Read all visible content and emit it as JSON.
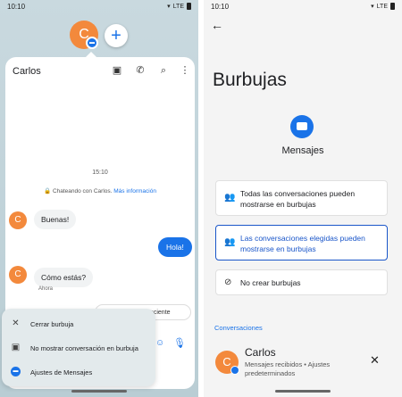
{
  "left": {
    "status": {
      "time": "10:10",
      "wifi_icon": "wifi-icon",
      "signal": "LTE",
      "battery_icon": "battery-icon"
    },
    "bubble": {
      "avatar_letter": "C",
      "add_icon": "+"
    },
    "chat": {
      "contact_name": "Carlos",
      "time_divider": "15:10",
      "info_prefix": "🔒 Chateando con Carlos.",
      "info_link": "Más información",
      "avatar_letter": "C",
      "messages": [
        {
          "direction": "in",
          "text": "Buenas!"
        },
        {
          "direction": "out",
          "text": "Hola!"
        },
        {
          "direction": "in",
          "text": "Cómo estás?"
        }
      ],
      "meta": "Ahora",
      "suggestion": "Adjuntar foto reciente"
    },
    "menu": {
      "items": [
        {
          "icon": "close-icon",
          "glyph": "✕",
          "label": "Cerrar burbuja"
        },
        {
          "icon": "no-bubble-icon",
          "glyph": "▣",
          "label": "No mostrar conversación en burbuja"
        },
        {
          "icon": "messages-app-icon",
          "glyph": "▬",
          "label": "Ajustes de Mensajes"
        }
      ]
    }
  },
  "right": {
    "status": {
      "time": "10:10",
      "wifi_icon": "wifi-icon",
      "signal": "LTE",
      "battery_icon": "battery-icon"
    },
    "title": "Burbujas",
    "app_name": "Mensajes",
    "options": [
      {
        "icon": "people-icon",
        "glyph": "👥",
        "label": "Todas las conversaciones pueden mostrarse en burbujas",
        "selected": false
      },
      {
        "icon": "people-outline-icon",
        "glyph": "👥",
        "label": "Las conversaciones elegidas pueden mostrarse en burbujas",
        "selected": true
      },
      {
        "icon": "block-icon",
        "glyph": "⊘",
        "label": "No crear burbujas",
        "selected": false
      }
    ],
    "section_label": "Conversaciones",
    "contact": {
      "avatar_letter": "C",
      "name": "Carlos",
      "subtitle": "Mensajes recibidos • Ajustes predeterminados"
    }
  },
  "colors": {
    "accent": "#1a73e8",
    "avatar": "#f3893c",
    "selected_border": "#1a56c9"
  }
}
